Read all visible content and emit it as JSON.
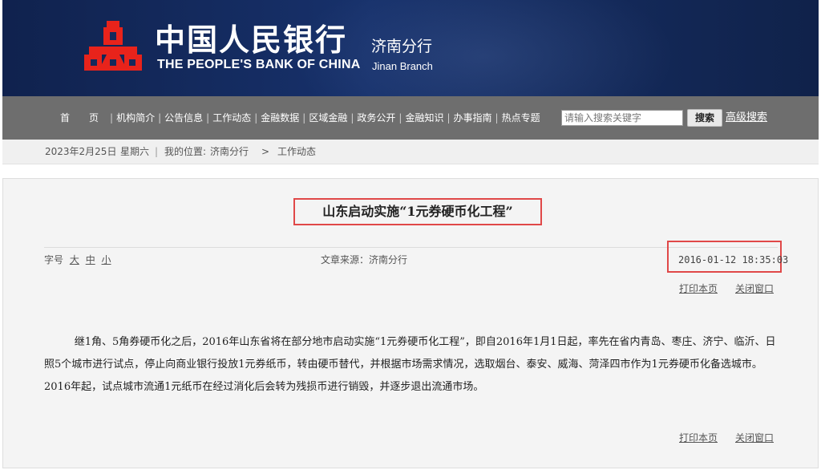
{
  "header": {
    "bank_name_cn": "中国人民银行",
    "bank_name_en": "THE PEOPLE'S BANK OF CHINA",
    "branch_cn": "济南分行",
    "branch_en": "Jinan Branch",
    "logo_icon": "pboc-logo-icon",
    "logo_color": "#e8231b",
    "bg_color": "#14295b"
  },
  "nav": {
    "items": [
      "首页",
      "机构简介",
      "公告信息",
      "工作动态",
      "金融数据",
      "区域金融",
      "政务公开",
      "金融知识",
      "办事指南",
      "热点专题"
    ],
    "search_placeholder": "请输入搜索关键字",
    "search_button": "搜索",
    "advanced_search": "高级搜索"
  },
  "crumb": {
    "date": "2023年2月25日",
    "weekday": "星期六",
    "location_label": "我的位置:",
    "items": [
      "济南分行",
      "工作动态"
    ],
    "separator": ">"
  },
  "article": {
    "title": "山东启动实施“1元券硬币化工程”",
    "font_size_label": "字号",
    "font_sizes": [
      "大",
      "中",
      "小"
    ],
    "source": "文章来源：济南分行",
    "datetime": "2016-01-12 18:35:03",
    "print_label": "打印本页",
    "close_label": "关闭窗口",
    "body": "继1角、5角券硬币化之后，2016年山东省将在部分地市启动实施“1元券硬币化工程”，即自2016年1月1日起，率先在省内青岛、枣庄、济宁、临沂、日照5个城市进行试点，停止向商业银行投放1元券纸币，转由硬币替代，并根据市场需求情况，选取烟台、泰安、威海、菏泽四市作为1元券硬币化备选城市。2016年起，试点城市流通1元纸币在经过消化后会转为残损币进行销毁，并逐步退出流通市场。",
    "highlight_color": "#e04848"
  }
}
